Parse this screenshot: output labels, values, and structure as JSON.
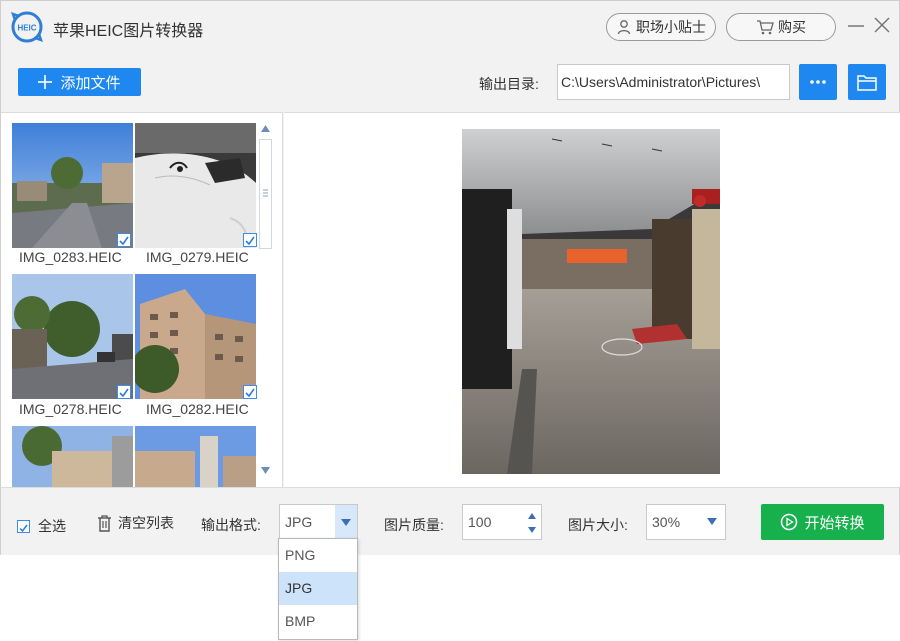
{
  "app": {
    "title": "苹果HEIC图片转换器",
    "logo_text": "HEIC",
    "tips_button": "职场小贴士",
    "buy_button": "购买"
  },
  "toolbar": {
    "add_files": "添加文件",
    "output_dir_label": "输出目录:",
    "output_dir_path": "C:\\Users\\Administrator\\Pictures\\"
  },
  "thumbnails": [
    {
      "name": "IMG_0283.HEIC",
      "checked": true
    },
    {
      "name": "IMG_0279.HEIC",
      "checked": true
    },
    {
      "name": "IMG_0278.HEIC",
      "checked": true
    },
    {
      "name": "IMG_0282.HEIC",
      "checked": true
    }
  ],
  "bottom": {
    "select_all": "全选",
    "clear_list": "清空列表",
    "format_label": "输出格式:",
    "format_value": "JPG",
    "quality_label": "图片质量:",
    "quality_value": "100",
    "size_label": "图片大小:",
    "size_value": "30%",
    "start_button": "开始转换"
  },
  "format_options": [
    "PNG",
    "JPG",
    "BMP"
  ],
  "colors": {
    "primary_blue": "#1e88f0",
    "start_green": "#16b04c",
    "selected_option": "#cde3fa"
  }
}
